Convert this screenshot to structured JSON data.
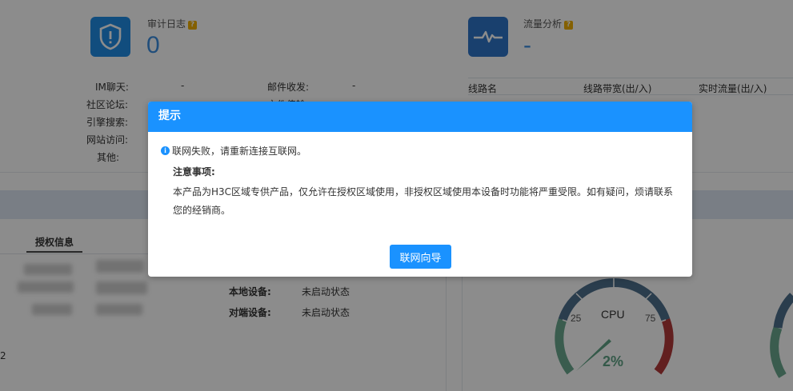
{
  "stats": {
    "audit": {
      "title": "审计日志",
      "value": "0"
    },
    "traffic": {
      "title": "流量分析",
      "value": "-"
    }
  },
  "audit_rows": [
    {
      "label": "IM聊天:",
      "value": "-"
    },
    {
      "label": "社区论坛:",
      "value": ""
    },
    {
      "label": "引擎搜索:",
      "value": ""
    },
    {
      "label": "网站访问:",
      "value": ""
    },
    {
      "label": "其他:",
      "value": ""
    }
  ],
  "audit_rows_right": [
    {
      "label": "邮件收发:",
      "value": "-"
    },
    {
      "label": "文件传输:",
      "value": ""
    }
  ],
  "traffic_table": {
    "headers": [
      "线路名",
      "线路带宽(出/入)",
      "实时流量(出/入)"
    ]
  },
  "auth_tab": {
    "label": "授权信息"
  },
  "devices": [
    {
      "label": "本地设备:",
      "status": "未启动状态"
    },
    {
      "label": "对端设备:",
      "status": "未启动状态"
    }
  ],
  "cut_digit": "2",
  "gauge": {
    "name": "CPU",
    "value_text": "2%",
    "value": 2,
    "ticks": [
      "25",
      "75"
    ],
    "colors": {
      "low": "#6aa88f",
      "mid": "#4e6f8c",
      "high": "#b33a3a",
      "value": "#5fa385"
    }
  },
  "modal": {
    "title": "提示",
    "message": "联网失败，请重新连接互联网。",
    "notice_title": "注意事项:",
    "notice_text": "本产品为H3C区域专供产品，仅允许在授权区域使用，非授权区域使用本设备时功能将严重受限。如有疑问，烦请联系您的经销商。",
    "button_label": "联网向导",
    "accent": "#1a92ff"
  }
}
